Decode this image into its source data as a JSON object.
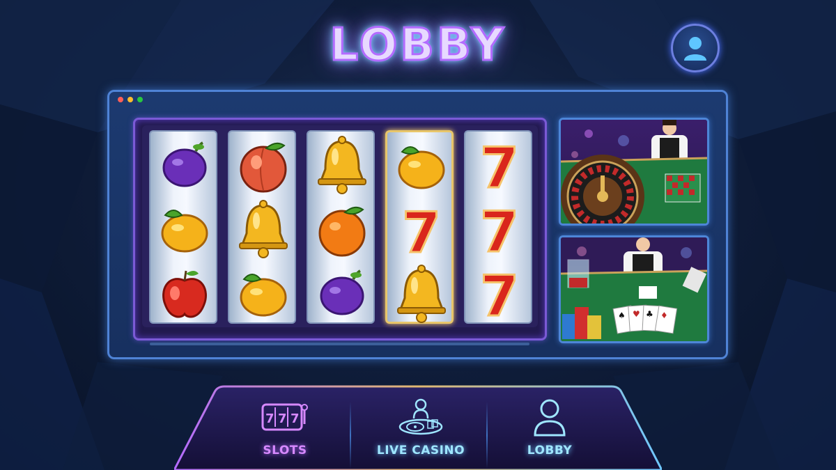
{
  "header": {
    "title": "LOBBY"
  },
  "profile": {
    "icon": "user-icon"
  },
  "window": {
    "dots": [
      "#ff5f57",
      "#febc2e",
      "#28c840"
    ]
  },
  "slots": {
    "reels": [
      {
        "symbols": [
          "plum",
          "lemon",
          "apple"
        ],
        "highlighted": false
      },
      {
        "symbols": [
          "peach",
          "bell",
          "lemon"
        ],
        "highlighted": false
      },
      {
        "symbols": [
          "bell",
          "orange",
          "plum"
        ],
        "highlighted": false
      },
      {
        "symbols": [
          "lemon",
          "seven",
          "bell"
        ],
        "highlighted": true
      },
      {
        "symbols": [
          "seven",
          "seven",
          "seven"
        ],
        "highlighted": false
      }
    ]
  },
  "live_tiles": [
    {
      "game": "roulette",
      "icon": "roulette-dealer-icon"
    },
    {
      "game": "blackjack",
      "icon": "blackjack-dealer-icon"
    }
  ],
  "nav": {
    "items": [
      {
        "label": "SLOTS",
        "icon": "slot-machine-icon",
        "color": "#d789ff"
      },
      {
        "label": "LIVE CASINO",
        "icon": "live-dealer-icon",
        "color": "#9fe6ff"
      },
      {
        "label": "LOBBY",
        "icon": "user-icon",
        "color": "#9fe6ff"
      }
    ]
  },
  "colors": {
    "neon_purple": "#b36bff",
    "neon_blue": "#6fc7ff",
    "panel_border": "#4f83d6",
    "gold": "#e8c66a"
  }
}
